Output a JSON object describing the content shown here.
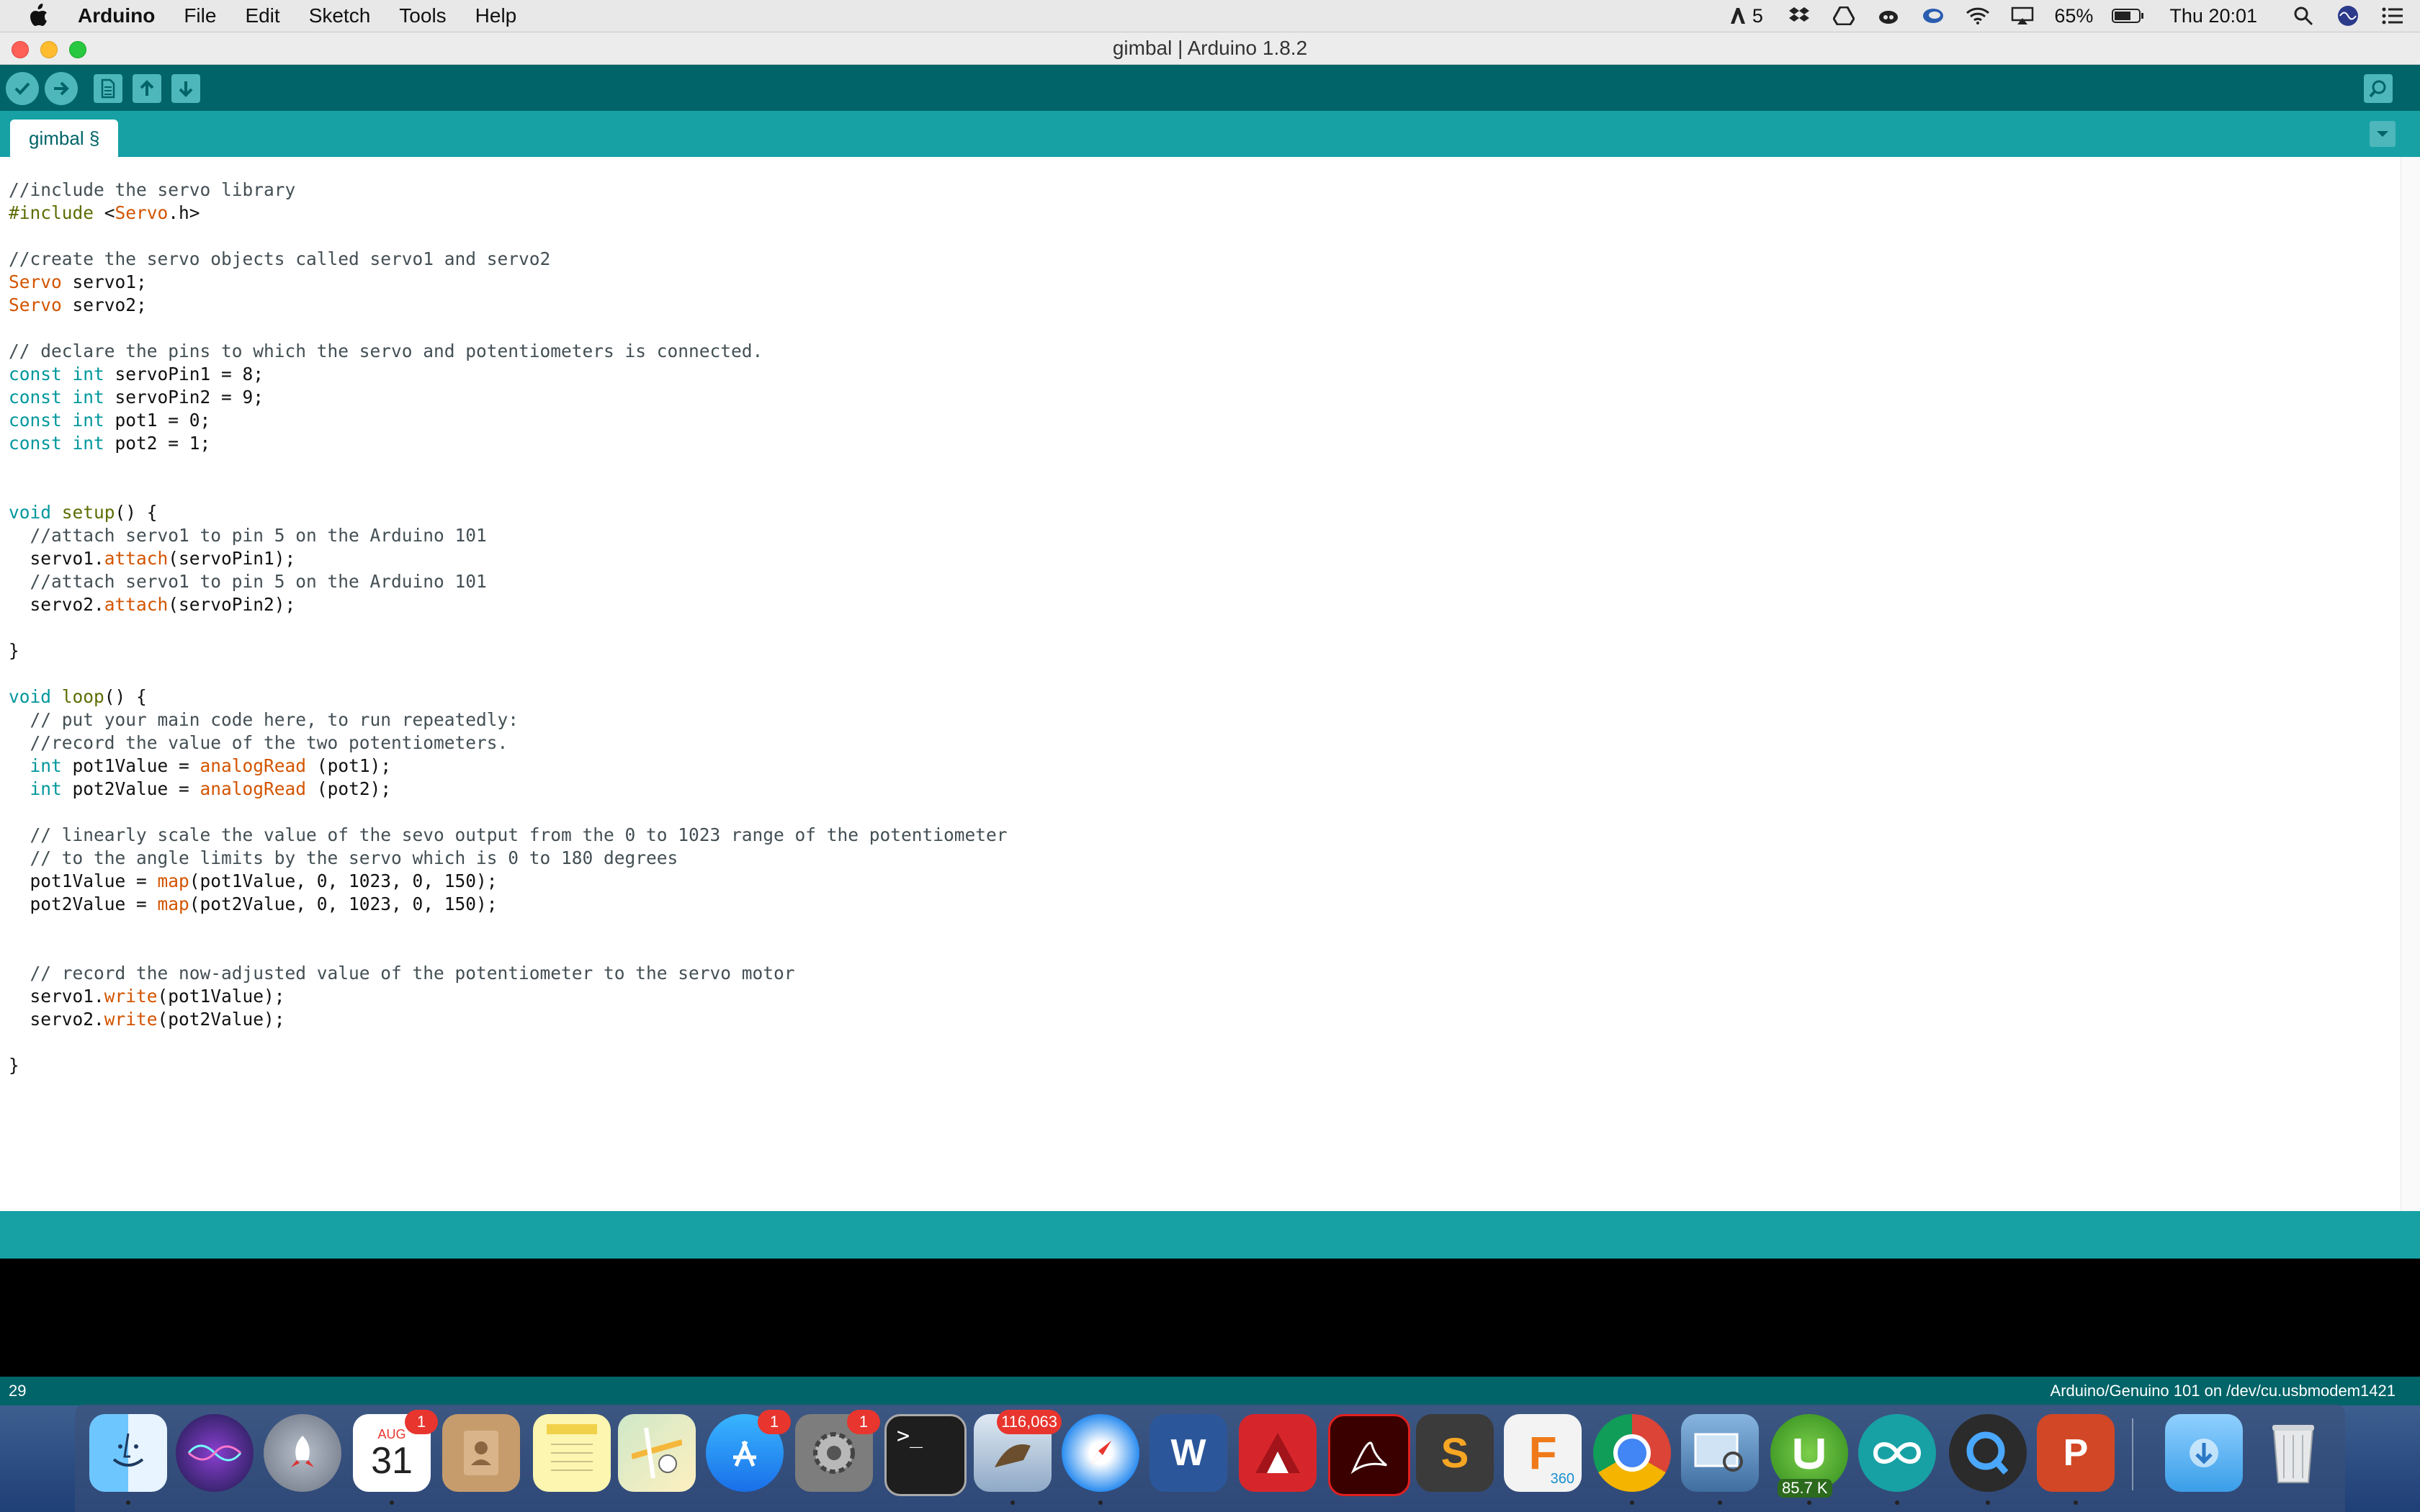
{
  "menubar": {
    "app_name": "Arduino",
    "menus": [
      "File",
      "Edit",
      "Sketch",
      "Tools",
      "Help"
    ],
    "status": {
      "adobe_count": "5",
      "battery": "65%",
      "clock": "Thu 20:01"
    }
  },
  "window": {
    "title": "gimbal | Arduino 1.8.2"
  },
  "tab": {
    "label": "gimbal §"
  },
  "code_lines": [
    [
      [
        "cm",
        "//include the servo library"
      ]
    ],
    [
      [
        "pp",
        "#include "
      ],
      [
        "",
        "<"
      ],
      [
        "ty",
        "Servo"
      ],
      [
        "",
        ".h>"
      ]
    ],
    [
      [
        "",
        ""
      ]
    ],
    [
      [
        "cm",
        "//create the servo objects called servo1 and servo2"
      ]
    ],
    [
      [
        "ty",
        "Servo"
      ],
      [
        "",
        " servo1;"
      ]
    ],
    [
      [
        "ty",
        "Servo"
      ],
      [
        "",
        " servo2;"
      ]
    ],
    [
      [
        "",
        ""
      ]
    ],
    [
      [
        "cm",
        "// declare the pins to which the servo and potentiometers is connected."
      ]
    ],
    [
      [
        "kw",
        "const"
      ],
      [
        "",
        " "
      ],
      [
        "kw",
        "int"
      ],
      [
        "",
        " servoPin1 = 8;"
      ]
    ],
    [
      [
        "kw",
        "const"
      ],
      [
        "",
        " "
      ],
      [
        "kw",
        "int"
      ],
      [
        "",
        " servoPin2 = 9;"
      ]
    ],
    [
      [
        "kw",
        "const"
      ],
      [
        "",
        " "
      ],
      [
        "kw",
        "int"
      ],
      [
        "",
        " pot1 = 0;"
      ]
    ],
    [
      [
        "kw",
        "const"
      ],
      [
        "",
        " "
      ],
      [
        "kw",
        "int"
      ],
      [
        "",
        " pot2 = 1;"
      ]
    ],
    [
      [
        "",
        ""
      ]
    ],
    [
      [
        "",
        ""
      ]
    ],
    [
      [
        "kw",
        "void"
      ],
      [
        "",
        " "
      ],
      [
        "pp",
        "setup"
      ],
      [
        "",
        "() {"
      ]
    ],
    [
      [
        "",
        "  "
      ],
      [
        "cm",
        "//attach servo1 to pin 5 on the Arduino 101"
      ]
    ],
    [
      [
        "",
        "  servo1."
      ],
      [
        "fn",
        "attach"
      ],
      [
        "",
        "(servoPin1);"
      ]
    ],
    [
      [
        "",
        "  "
      ],
      [
        "cm",
        "//attach servo1 to pin 5 on the Arduino 101"
      ]
    ],
    [
      [
        "",
        "  servo2."
      ],
      [
        "fn",
        "attach"
      ],
      [
        "",
        "(servoPin2);"
      ]
    ],
    [
      [
        "",
        ""
      ]
    ],
    [
      [
        "",
        "}"
      ]
    ],
    [
      [
        "",
        ""
      ]
    ],
    [
      [
        "kw",
        "void"
      ],
      [
        "",
        " "
      ],
      [
        "pp",
        "loop"
      ],
      [
        "",
        "() {"
      ]
    ],
    [
      [
        "",
        "  "
      ],
      [
        "cm",
        "// put your main code here, to run repeatedly:"
      ]
    ],
    [
      [
        "",
        "  "
      ],
      [
        "cm",
        "//record the value of the two potentiometers."
      ]
    ],
    [
      [
        "",
        "  "
      ],
      [
        "kw",
        "int"
      ],
      [
        "",
        " pot1Value = "
      ],
      [
        "fn",
        "analogRead"
      ],
      [
        "",
        " (pot1);"
      ]
    ],
    [
      [
        "",
        "  "
      ],
      [
        "kw",
        "int"
      ],
      [
        "",
        " pot2Value = "
      ],
      [
        "fn",
        "analogRead"
      ],
      [
        "",
        " (pot2);"
      ]
    ],
    [
      [
        "",
        ""
      ]
    ],
    [
      [
        "",
        "  "
      ],
      [
        "cm",
        "// linearly scale the value of the sevo output from the 0 to 1023 range of the potentiometer"
      ]
    ],
    [
      [
        "",
        "  "
      ],
      [
        "cm",
        "// to the angle limits by the servo which is 0 to 180 degrees"
      ]
    ],
    [
      [
        "",
        "  pot1Value = "
      ],
      [
        "fn",
        "map"
      ],
      [
        "",
        "(pot1Value, 0, 1023, 0, 150);"
      ]
    ],
    [
      [
        "",
        "  pot2Value = "
      ],
      [
        "fn",
        "map"
      ],
      [
        "",
        "(pot2Value, 0, 1023, 0, 150);"
      ]
    ],
    [
      [
        "",
        ""
      ]
    ],
    [
      [
        "",
        ""
      ]
    ],
    [
      [
        "",
        "  "
      ],
      [
        "cm",
        "// record the now-adjusted value of the potentiometer to the servo motor"
      ]
    ],
    [
      [
        "",
        "  servo1."
      ],
      [
        "fn",
        "write"
      ],
      [
        "",
        "(pot1Value);"
      ]
    ],
    [
      [
        "",
        "  servo2."
      ],
      [
        "fn",
        "write"
      ],
      [
        "",
        "(pot2Value);"
      ]
    ],
    [
      [
        "",
        ""
      ]
    ],
    [
      [
        "",
        "}"
      ]
    ]
  ],
  "statusbar": {
    "line_number": "29",
    "board_port": "Arduino/Genuino 101 on /dev/cu.usbmodem1421"
  },
  "dock": {
    "calendar_month": "AUG",
    "calendar_day": "31",
    "calendar_badge": "1",
    "appstore_badge": "1",
    "prefs_badge": "1",
    "mail_badge": "116,063",
    "fusion_label": "360",
    "utorrent_label": "85.7 K",
    "word_letter": "W",
    "ppt_letter": "P",
    "sublime_letter": "S",
    "fusion_letter": "F",
    "terminal_prompt": ">_"
  },
  "colors": {
    "toolbar": "#006468",
    "tabstrip": "#17a1a5",
    "keyword": "#00979c",
    "type": "#d35400",
    "comment": "#434f54"
  }
}
